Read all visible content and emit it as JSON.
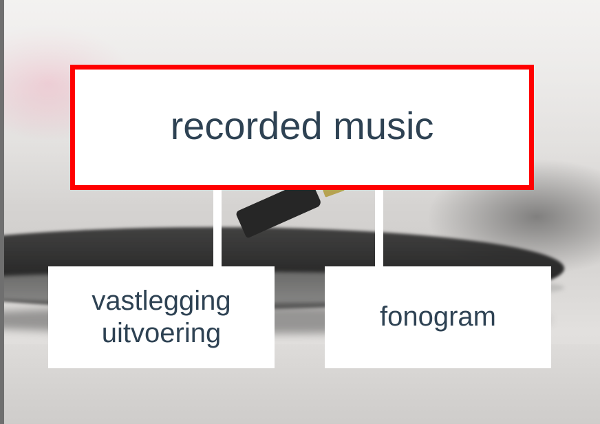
{
  "diagram": {
    "root": {
      "label": "recorded music",
      "border_color": "#ff0000",
      "text_color": "#2e4253"
    },
    "children": [
      {
        "label": "vastlegging\nuitvoering"
      },
      {
        "label": "fonogram"
      }
    ]
  }
}
